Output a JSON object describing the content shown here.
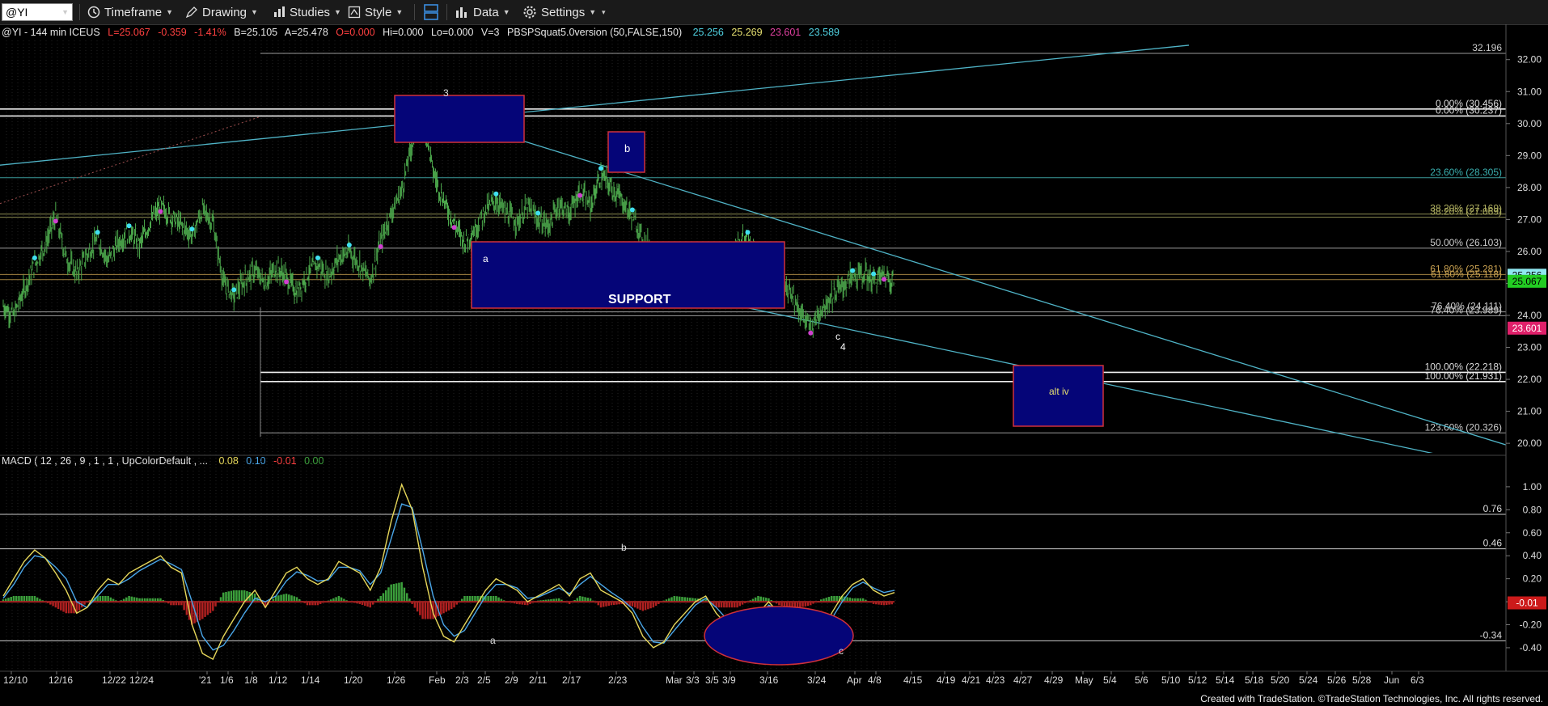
{
  "toolbar": {
    "symbol": "@YI",
    "timeframe": "Timeframe",
    "drawing": "Drawing",
    "studies": "Studies",
    "style": "Style",
    "data": "Data",
    "settings": "Settings"
  },
  "header": {
    "symbol_info": "@YI - 144 min  ICEUS",
    "last": "L=25.067",
    "change": "-0.359",
    "change_pct": "-1.41%",
    "bid": "B=25.105",
    "ask": "A=25.478",
    "open": "O=0.000",
    "hi": "Hi=0.000",
    "lo": "Lo=0.000",
    "vol": "V=3",
    "study": "PBSPSquat5.0version (50,FALSE,150)",
    "study_values": [
      "25.256",
      "25.269",
      "23.601",
      "23.589"
    ]
  },
  "macd_header": {
    "label": "MACD ( 12 , 26 , 9 , 1 , 1 , UpColorDefault , ...",
    "values": [
      "0.08",
      "0.10",
      "-0.01",
      "0.00"
    ]
  },
  "colors": {
    "bg": "#000000",
    "grid": "#2a2a2a",
    "bars": "#4ca84c",
    "wedge": "#4fb3c6",
    "box_fill": "#050578",
    "box_border": "#d0303a",
    "level": "#d8d8d8",
    "macd_line": "#e6d75a",
    "signal_line": "#4aa6e8",
    "hist_pos": "#3ca03c",
    "hist_neg": "#b02020",
    "price_tag": "#22cc22",
    "low_tag": "#e0206a"
  },
  "chart_data": [
    {
      "type": "line",
      "title": "@YI - 144 min",
      "ylim": [
        19.7,
        32.6
      ],
      "y_ticks": [
        20.0,
        21.0,
        22.0,
        23.0,
        24.0,
        25.0,
        26.0,
        27.0,
        28.0,
        29.0,
        30.0,
        31.0,
        32.0
      ],
      "x_tick_labels": [
        "12/10",
        "12/16",
        "12/22",
        "12/24",
        "'21",
        "1/6",
        "1/8",
        "1/12",
        "1/14",
        "1/20",
        "1/26",
        "Feb",
        "2/3",
        "2/5",
        "2/9",
        "2/11",
        "2/17",
        "2/23",
        "Mar",
        "3/3",
        "3/5",
        "3/9",
        "3/16",
        "3/24",
        "Apr",
        "4/8",
        "4/15",
        "4/19",
        "4/21",
        "4/23",
        "4/27",
        "4/29",
        "May",
        "5/4",
        "5/6",
        "5/10",
        "5/12",
        "5/14",
        "5/18",
        "5/20",
        "5/24",
        "5/26",
        "5/28",
        "Jun",
        "6/3"
      ],
      "series": [
        {
          "values": [
            24.3,
            24.0,
            24.8,
            25.6,
            26.2,
            27.1,
            25.8,
            25.3,
            25.9,
            26.4,
            25.7,
            26.3,
            26.6,
            26.2,
            26.9,
            27.4,
            27.1,
            26.8,
            26.5,
            27.3,
            26.9,
            25.0,
            24.6,
            25.1,
            25.4,
            25.0,
            25.5,
            25.2,
            24.7,
            25.3,
            25.6,
            25.2,
            25.8,
            26.0,
            25.6,
            25.1,
            26.3,
            27.2,
            27.9,
            29.4,
            30.35,
            28.5,
            27.6,
            26.9,
            26.3,
            26.7,
            27.3,
            27.6,
            27.2,
            26.9,
            27.4,
            27.0,
            26.8,
            27.5,
            27.2,
            27.9,
            27.4,
            28.4,
            28.0,
            27.6,
            27.1,
            26.4,
            26.0,
            25.4,
            25.0,
            25.7,
            25.3,
            25.9,
            25.2,
            25.8,
            26.2,
            26.4,
            25.8,
            25.2,
            24.6,
            24.9,
            24.1,
            23.6,
            24.2,
            24.6,
            24.9,
            25.2,
            25.3,
            25.1,
            25.28,
            25.067
          ]
        }
      ],
      "fib_levels": [
        {
          "value": 32.196,
          "label": "32.196"
        },
        {
          "value": 30.456,
          "label": "0.00% (30.456)"
        },
        {
          "value": 30.237,
          "label": "0.00% (30.237)"
        },
        {
          "value": 28.305,
          "label": "23.60% (28.305)"
        },
        {
          "value": 27.169,
          "label": "38.20% (27.169)"
        },
        {
          "value": 27.069,
          "label": "38.20% (27.069)"
        },
        {
          "value": 26.103,
          "label": "50.00% (26.103)"
        },
        {
          "value": 25.281,
          "label": "61.80% (25.281)"
        },
        {
          "value": 25.118,
          "label": "61.80% (25.118)"
        },
        {
          "value": 24.111,
          "label": "76.40% (24.111)"
        },
        {
          "value": 23.989,
          "label": "76.40% (23.989)"
        },
        {
          "value": 22.218,
          "label": "100.00% (22.218)"
        },
        {
          "value": 21.931,
          "label": "100.00% (21.931)"
        },
        {
          "value": 20.326,
          "label": "123.60% (20.326)"
        }
      ],
      "price_tags": {
        "last": "25.256",
        "current": "25.067",
        "low": "23.601"
      },
      "annotations": [
        "3",
        "b",
        "a",
        "SUPPORT",
        "c",
        "4",
        "alt iv"
      ]
    },
    {
      "type": "line",
      "title": "MACD ( 12 , 26 , 9 , 1 , 1 , UpColorDefault , ...",
      "ylim": [
        -0.52,
        1.14
      ],
      "y_ticks": [
        -0.4,
        -0.2,
        0.0,
        0.2,
        0.4,
        0.6,
        0.8,
        1.0
      ],
      "level_labels": [
        "0.76",
        "0.46",
        "-0.34"
      ],
      "last_value": "-0.01",
      "series": [
        {
          "name": "MACD",
          "values": [
            0.05,
            0.2,
            0.35,
            0.45,
            0.38,
            0.25,
            0.1,
            -0.1,
            -0.05,
            0.1,
            0.2,
            0.15,
            0.25,
            0.3,
            0.35,
            0.4,
            0.3,
            0.25,
            -0.2,
            -0.45,
            -0.5,
            -0.3,
            -0.15,
            0.0,
            0.1,
            -0.05,
            0.1,
            0.25,
            0.3,
            0.2,
            0.15,
            0.2,
            0.35,
            0.3,
            0.25,
            0.1,
            0.3,
            0.7,
            1.02,
            0.8,
            0.3,
            -0.1,
            -0.3,
            -0.35,
            -0.2,
            -0.05,
            0.1,
            0.2,
            0.15,
            0.1,
            0.0,
            0.05,
            0.1,
            0.15,
            0.05,
            0.2,
            0.25,
            0.1,
            0.05,
            0.0,
            -0.1,
            -0.3,
            -0.4,
            -0.35,
            -0.2,
            -0.1,
            0.0,
            0.05,
            -0.1,
            -0.2,
            -0.3,
            -0.25,
            -0.1,
            0.0,
            -0.1,
            -0.25,
            -0.35,
            -0.4,
            -0.3,
            -0.1,
            0.05,
            0.15,
            0.2,
            0.1,
            0.05,
            0.08
          ]
        },
        {
          "name": "Signal",
          "values": [
            0.03,
            0.15,
            0.3,
            0.4,
            0.38,
            0.3,
            0.2,
            0.0,
            -0.05,
            0.05,
            0.15,
            0.15,
            0.2,
            0.27,
            0.32,
            0.37,
            0.33,
            0.28,
            0.0,
            -0.3,
            -0.42,
            -0.38,
            -0.25,
            -0.1,
            0.03,
            0.0,
            0.05,
            0.18,
            0.26,
            0.23,
            0.18,
            0.19,
            0.3,
            0.3,
            0.27,
            0.15,
            0.25,
            0.55,
            0.85,
            0.82,
            0.45,
            0.05,
            -0.2,
            -0.3,
            -0.25,
            -0.1,
            0.05,
            0.15,
            0.15,
            0.12,
            0.03,
            0.04,
            0.08,
            0.12,
            0.07,
            0.15,
            0.22,
            0.15,
            0.08,
            0.02,
            -0.06,
            -0.22,
            -0.35,
            -0.36,
            -0.25,
            -0.14,
            -0.03,
            0.03,
            -0.05,
            -0.15,
            -0.25,
            -0.25,
            -0.15,
            -0.03,
            -0.07,
            -0.2,
            -0.3,
            -0.37,
            -0.32,
            -0.15,
            0.0,
            0.12,
            0.17,
            0.12,
            0.08,
            0.1
          ]
        }
      ],
      "annotations": [
        "b",
        "a",
        "c"
      ]
    }
  ],
  "footer": "Created with TradeStation. ©TradeStation Technologies, Inc. All rights reserved."
}
